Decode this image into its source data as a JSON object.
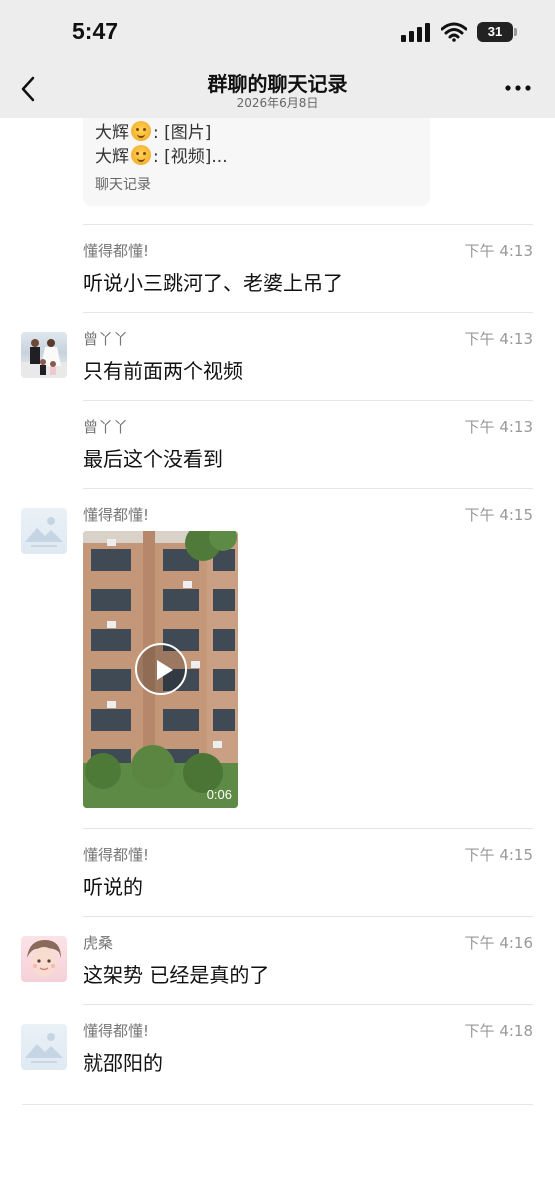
{
  "status_bar": {
    "time": "5:47",
    "battery": "31"
  },
  "nav": {
    "title": "群聊的聊天记录",
    "subtitle": "2026年6月8日"
  },
  "forwarded_card": {
    "lines": [
      {
        "sender": "大辉",
        "content": ": [图片]"
      },
      {
        "sender": "大辉",
        "content": ": [视频]..."
      }
    ],
    "footer": "聊天记录"
  },
  "messages": [
    {
      "sender": "懂得都懂!",
      "time": "下午 4:13",
      "text": "听说小三跳河了、老婆上吊了",
      "avatar": "none"
    },
    {
      "sender": "曾丫丫",
      "time": "下午 4:13",
      "text": "只有前面两个视频",
      "avatar": "wedding-photo"
    },
    {
      "sender": "曾丫丫",
      "time": "下午 4:13",
      "text": "最后这个没看到",
      "avatar": "none"
    },
    {
      "sender": "懂得都懂!",
      "time": "下午 4:15",
      "video_duration": "0:06",
      "avatar": "placeholder"
    },
    {
      "sender": "懂得都懂!",
      "time": "下午 4:15",
      "text": "听说的",
      "avatar": "none"
    },
    {
      "sender": "虎桑",
      "time": "下午 4:16",
      "text": "这架势 已经是真的了",
      "avatar": "cartoon"
    },
    {
      "sender": "懂得都懂!",
      "time": "下午 4:18",
      "text": "就邵阳的",
      "avatar": "placeholder"
    }
  ],
  "colors": {
    "header_bg": "#ededed",
    "divider": "#e5e5e5",
    "meta_text": "#999999"
  }
}
